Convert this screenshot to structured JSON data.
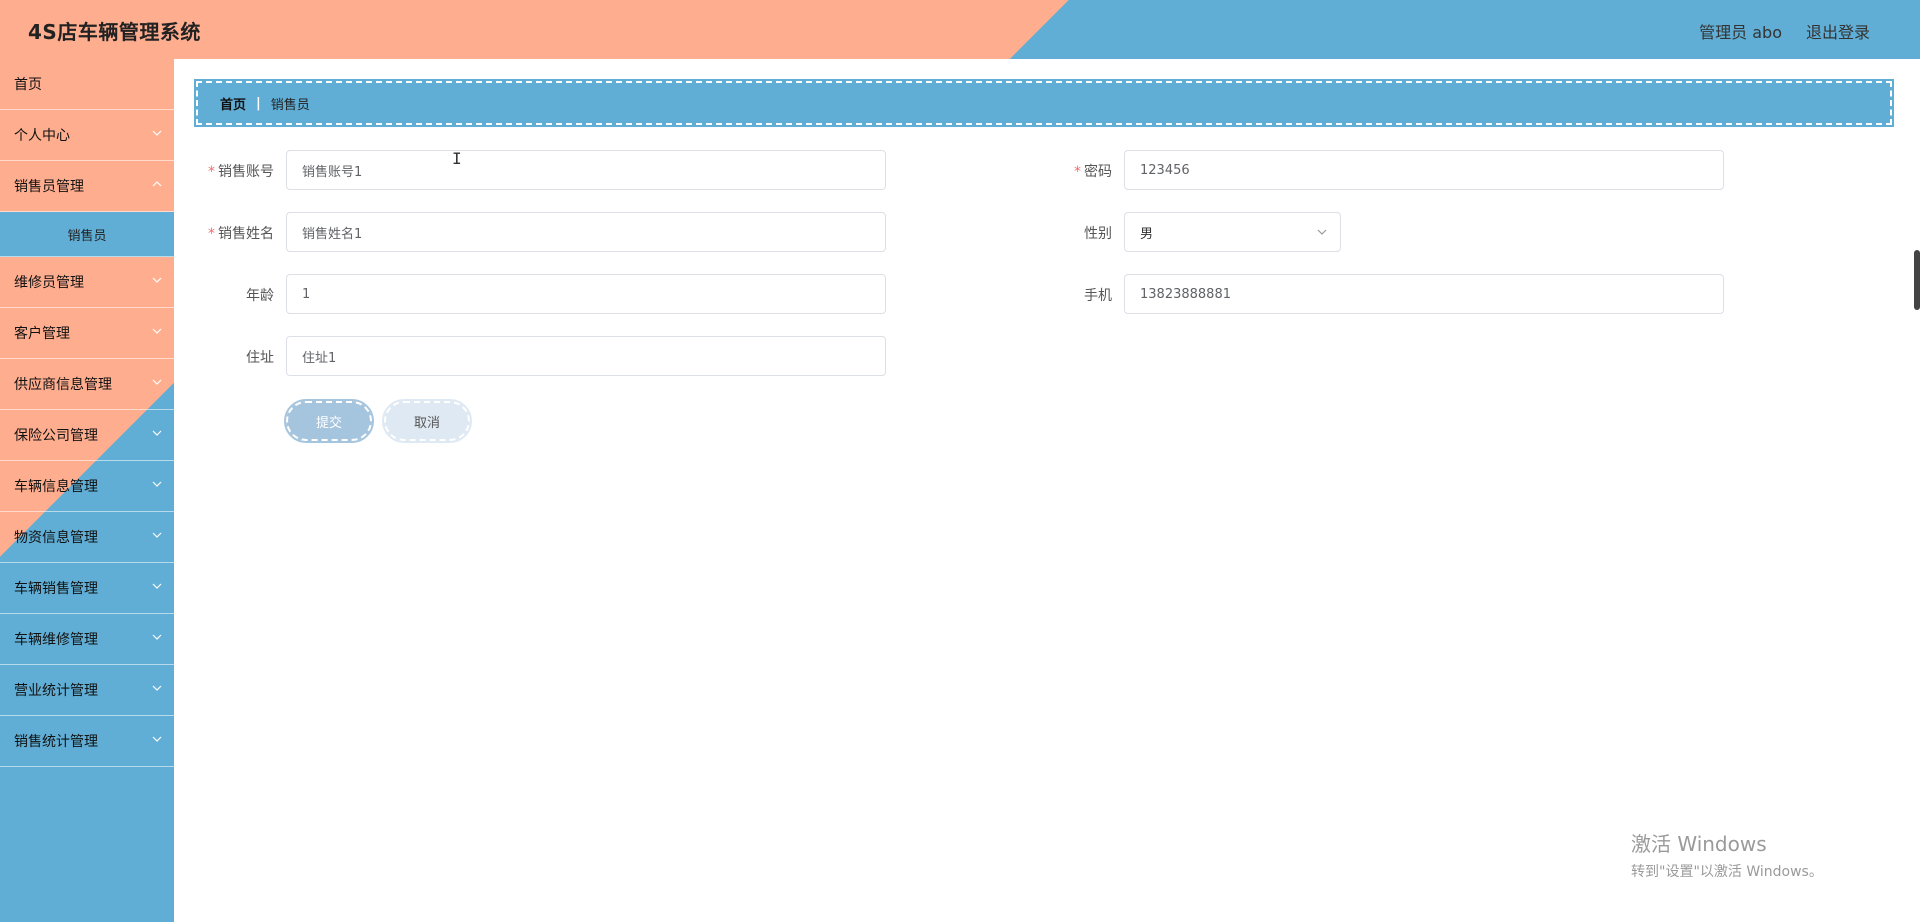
{
  "header": {
    "title": "4S店车辆管理系统",
    "user_label": "管理员 abo",
    "logout_label": "退出登录"
  },
  "sidebar": {
    "items": [
      {
        "label": "首页",
        "has_chevron": false
      },
      {
        "label": "个人中心",
        "has_chevron": true
      },
      {
        "label": "销售员管理",
        "has_chevron": true,
        "expanded": true,
        "sub": "销售员"
      },
      {
        "label": "维修员管理",
        "has_chevron": true
      },
      {
        "label": "客户管理",
        "has_chevron": true
      },
      {
        "label": "供应商信息管理",
        "has_chevron": true
      },
      {
        "label": "保险公司管理",
        "has_chevron": true
      },
      {
        "label": "车辆信息管理",
        "has_chevron": true
      },
      {
        "label": "物资信息管理",
        "has_chevron": true
      },
      {
        "label": "车辆销售管理",
        "has_chevron": true
      },
      {
        "label": "车辆维修管理",
        "has_chevron": true
      },
      {
        "label": "营业统计管理",
        "has_chevron": true
      },
      {
        "label": "销售统计管理",
        "has_chevron": true
      }
    ]
  },
  "breadcrumb": {
    "home": "首页",
    "separator": "|",
    "current": "销售员"
  },
  "form": {
    "account_label": "销售账号",
    "account_value": "销售账号1",
    "password_label": "密码",
    "password_value": "123456",
    "name_label": "销售姓名",
    "name_value": "销售姓名1",
    "gender_label": "性别",
    "gender_value": "男",
    "age_label": "年龄",
    "age_value": "1",
    "phone_label": "手机",
    "phone_value": "13823888881",
    "address_label": "住址",
    "address_value": "住址1",
    "required_mark": "*",
    "submit_label": "提交",
    "cancel_label": "取消"
  },
  "watermark": {
    "line1": "激活 Windows",
    "line2": "转到\"设置\"以激活 Windows。"
  },
  "colors": {
    "salmon": "#ffad8f",
    "blue": "#60aed5",
    "required": "#f56c6c"
  }
}
